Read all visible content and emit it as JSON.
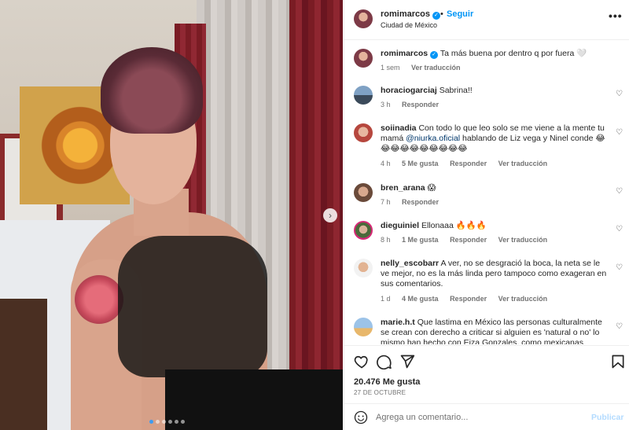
{
  "post": {
    "author": "romimarcos",
    "follow_label": "Seguir",
    "separator": "•",
    "location": "Ciudad de México",
    "more_icon": "more-horizontal-icon"
  },
  "caption": {
    "user": "romimarcos",
    "text": "Ta más buena por dentro q por fuera 🤍",
    "time": "1 sem",
    "translate": "Ver traducción"
  },
  "comments": [
    {
      "user": "horaciogarciaj",
      "text": "Sabrina!!",
      "time": "3 h",
      "likes": "",
      "reply": "Responder",
      "translate": ""
    },
    {
      "user": "soiinadia",
      "text_before": "Con todo lo que leo solo se me viene a la mente tu mamá ",
      "mention": "@niurka.oficial",
      "text_after": " hablando de Liz vega y Ninel conde 😂😂😂😂😂😂😂😂😂😂",
      "time": "4 h",
      "likes": "5 Me gusta",
      "reply": "Responder",
      "translate": "Ver traducción"
    },
    {
      "user": "bren_arana",
      "text": "😱",
      "time": "7 h",
      "likes": "",
      "reply": "Responder",
      "translate": ""
    },
    {
      "user": "dieguiniel",
      "text": "Ellonaaa 🔥🔥🔥",
      "time": "8 h",
      "likes": "1 Me gusta",
      "reply": "Responder",
      "translate": "Ver traducción"
    },
    {
      "user": "nelly_escobarr",
      "text": "A ver, no se desgració la boca, la neta se le ve mejor, no es la más linda pero tampoco como exageran en sus comentarios.",
      "time": "1 d",
      "likes": "4 Me gusta",
      "reply": "Responder",
      "translate": "Ver traducción"
    },
    {
      "user": "marie.h.t",
      "text": "Que lastima en México las personas culturalmente se crean con derecho a criticar si alguien es 'natural o no' lo mismo han hecho con Eiza Gonzales, como mexicanas",
      "time": "",
      "likes": "",
      "reply": "",
      "translate": ""
    }
  ],
  "actions": {
    "likes": "20.476 Me gusta",
    "date": "27 DE OCTUBRE",
    "icons": [
      "heart-icon",
      "comment-icon",
      "share-icon",
      "bookmark-icon"
    ]
  },
  "composer": {
    "placeholder": "Agrega un comentario...",
    "publish_label": "Publicar",
    "emoji_icon": "emoji-icon"
  },
  "carousel": {
    "slide_count": 6,
    "active_index": 0
  },
  "colors": {
    "accent": "#0095f6",
    "link": "#00376b",
    "muted": "#737373",
    "publish_disabled": "#b3dbff"
  }
}
